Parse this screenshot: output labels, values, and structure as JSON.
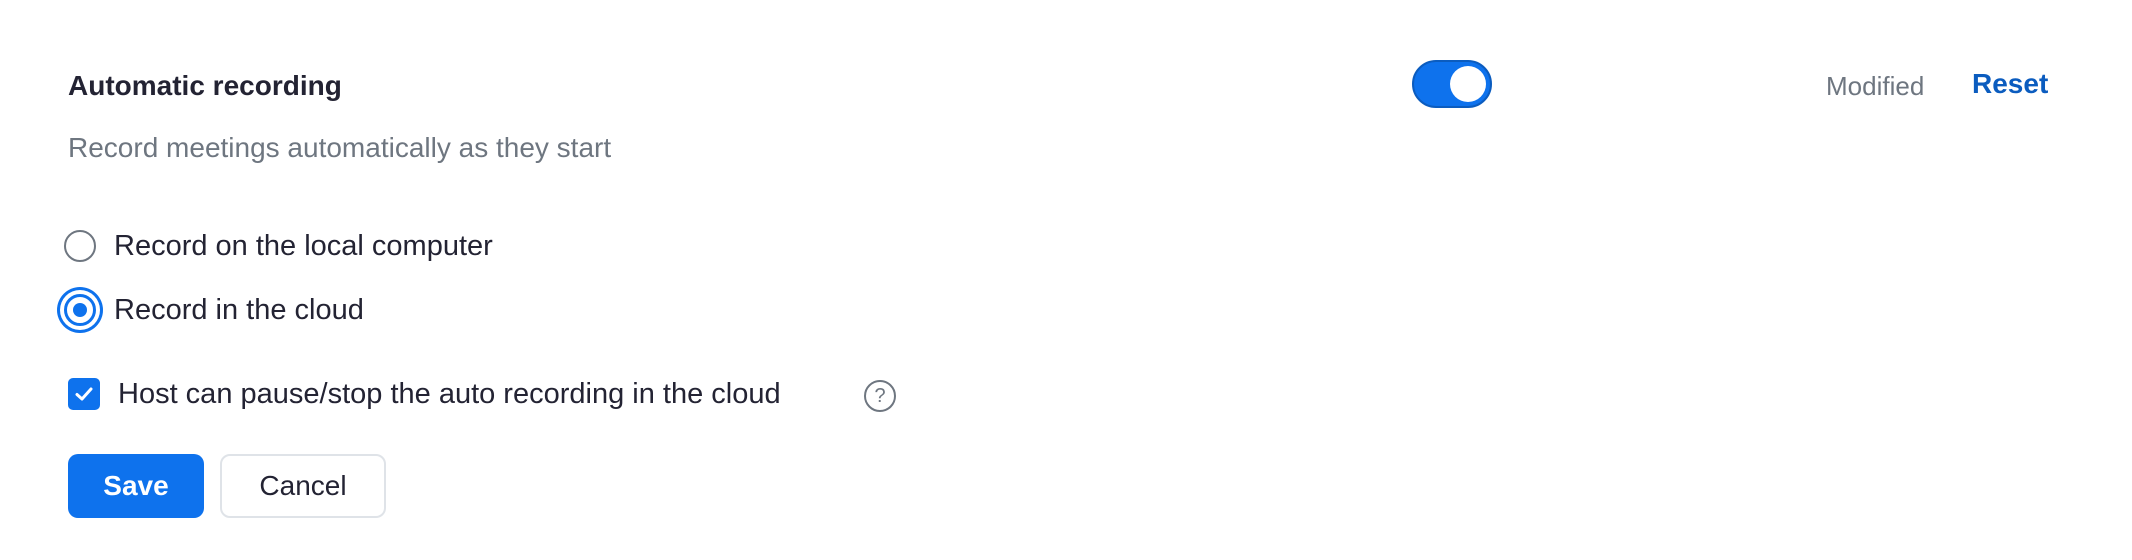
{
  "setting": {
    "title": "Automatic recording",
    "description": "Record meetings automatically as they start",
    "enabled": true,
    "status_text": "Modified",
    "reset_label": "Reset"
  },
  "options": [
    {
      "label": "Record on the local computer",
      "selected": false
    },
    {
      "label": "Record in the cloud",
      "selected": true
    }
  ],
  "checkbox": {
    "label": "Host can pause/stop the auto recording in the cloud",
    "checked": true
  },
  "help_icon": {
    "glyph": "?"
  },
  "buttons": {
    "save_label": "Save",
    "cancel_label": "Cancel"
  },
  "colors": {
    "accent": "#0e72ed",
    "link": "#0b5cbf",
    "muted_text": "#6e7680",
    "text": "#232333"
  }
}
